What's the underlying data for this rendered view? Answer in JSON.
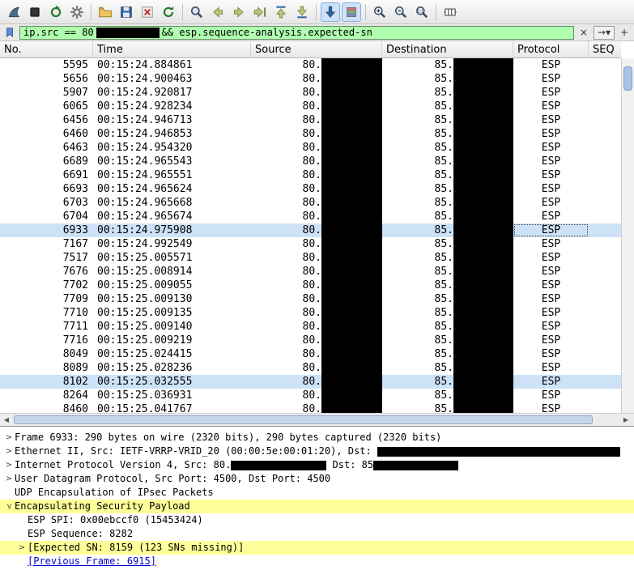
{
  "toolbar": {
    "icons": [
      {
        "name": "capture-interfaces-icon",
        "pressed": false
      },
      {
        "name": "capture-stop-icon",
        "pressed": false
      },
      {
        "name": "capture-restart-icon",
        "pressed": false
      },
      {
        "name": "capture-options-icon",
        "pressed": false
      },
      {
        "name": "open-capture-icon",
        "pressed": false
      },
      {
        "name": "save-capture-icon",
        "pressed": false
      },
      {
        "name": "close-capture-icon",
        "pressed": false
      },
      {
        "name": "reload-capture-icon",
        "pressed": false
      },
      {
        "name": "find-packet-icon",
        "pressed": false
      },
      {
        "name": "go-back-icon",
        "pressed": false
      },
      {
        "name": "go-forward-icon",
        "pressed": false
      },
      {
        "name": "goto-packet-icon",
        "pressed": false
      },
      {
        "name": "goto-first-icon",
        "pressed": false
      },
      {
        "name": "goto-last-icon",
        "pressed": false
      },
      {
        "name": "autoscroll-icon",
        "pressed": true
      },
      {
        "name": "colorize-icon",
        "pressed": true
      },
      {
        "name": "zoom-in-icon",
        "pressed": false
      },
      {
        "name": "zoom-out-icon",
        "pressed": false
      },
      {
        "name": "zoom-original-icon",
        "pressed": false
      },
      {
        "name": "resize-columns-icon",
        "pressed": false
      }
    ]
  },
  "filter": {
    "prefix": "ip.src == 80",
    "suffix": "&& esp.sequence-analysis.expected-sn",
    "clear_label": "×",
    "apply_label": "→",
    "dropdown_label": "▾",
    "add_label": "+"
  },
  "packet_list": {
    "columns": [
      "No.",
      "Time",
      "Source",
      "Destination",
      "Protocol",
      "SEQ"
    ],
    "source_prefix": "80.",
    "dest_prefix": "85.",
    "protocol": "ESP",
    "rows": [
      {
        "no": "5595",
        "time": "00:15:24.884861"
      },
      {
        "no": "5656",
        "time": "00:15:24.900463"
      },
      {
        "no": "5907",
        "time": "00:15:24.920817"
      },
      {
        "no": "6065",
        "time": "00:15:24.928234"
      },
      {
        "no": "6456",
        "time": "00:15:24.946713"
      },
      {
        "no": "6460",
        "time": "00:15:24.946853"
      },
      {
        "no": "6463",
        "time": "00:15:24.954320"
      },
      {
        "no": "6689",
        "time": "00:15:24.965543"
      },
      {
        "no": "6691",
        "time": "00:15:24.965551"
      },
      {
        "no": "6693",
        "time": "00:15:24.965624"
      },
      {
        "no": "6703",
        "time": "00:15:24.965668"
      },
      {
        "no": "6704",
        "time": "00:15:24.965674"
      },
      {
        "no": "6933",
        "time": "00:15:24.975908",
        "state": "focused"
      },
      {
        "no": "7167",
        "time": "00:15:24.992549"
      },
      {
        "no": "7517",
        "time": "00:15:25.005571"
      },
      {
        "no": "7676",
        "time": "00:15:25.008914"
      },
      {
        "no": "7702",
        "time": "00:15:25.009055"
      },
      {
        "no": "7709",
        "time": "00:15:25.009130"
      },
      {
        "no": "7710",
        "time": "00:15:25.009135"
      },
      {
        "no": "7711",
        "time": "00:15:25.009140"
      },
      {
        "no": "7716",
        "time": "00:15:25.009219"
      },
      {
        "no": "8049",
        "time": "00:15:25.024415"
      },
      {
        "no": "8089",
        "time": "00:15:25.028236"
      },
      {
        "no": "8102",
        "time": "00:15:25.032555",
        "state": "selected"
      },
      {
        "no": "8264",
        "time": "00:15:25.036931"
      },
      {
        "no": "8460",
        "time": "00:15:25.041767"
      }
    ]
  },
  "details": {
    "lines": [
      {
        "expand": "collapsed",
        "indent": 0,
        "parts": [
          {
            "text": "Frame 6933: 290 bytes on wire (2320 bits), 290 bytes captured (2320 bits)"
          }
        ]
      },
      {
        "expand": "collapsed",
        "indent": 0,
        "parts": [
          {
            "text": "Ethernet II, Src: IETF-VRRP-VRID_20 (00:00:5e:00:01:20), Dst: "
          },
          {
            "redact": 300
          }
        ]
      },
      {
        "expand": "collapsed",
        "indent": 0,
        "parts": [
          {
            "text": "Internet Protocol Version 4, Src: 80."
          },
          {
            "redact": 118
          },
          {
            "text": " Dst: 85"
          },
          {
            "redact": 105
          }
        ]
      },
      {
        "expand": "collapsed",
        "indent": 0,
        "parts": [
          {
            "text": "User Datagram Protocol, Src Port: 4500, Dst Port: 4500"
          }
        ]
      },
      {
        "expand": "none",
        "indent": 0,
        "parts": [
          {
            "text": "UDP Encapsulation of IPsec Packets"
          }
        ]
      },
      {
        "expand": "expanded",
        "indent": 0,
        "highlight": true,
        "parts": [
          {
            "text": "Encapsulating Security Payload"
          }
        ]
      },
      {
        "expand": "none",
        "indent": 1,
        "parts": [
          {
            "text": "ESP SPI: 0x00ebccf0 (15453424)"
          }
        ]
      },
      {
        "expand": "none",
        "indent": 1,
        "parts": [
          {
            "text": "ESP Sequence: 8282"
          }
        ]
      },
      {
        "expand": "collapsed",
        "indent": 1,
        "highlight": true,
        "parts": [
          {
            "text": "[Expected SN: 8159 (123 SNs missing)]"
          }
        ]
      },
      {
        "expand": "none",
        "indent": 1,
        "link": true,
        "parts": [
          {
            "text": "[Previous Frame: 6915]"
          }
        ]
      }
    ]
  }
}
